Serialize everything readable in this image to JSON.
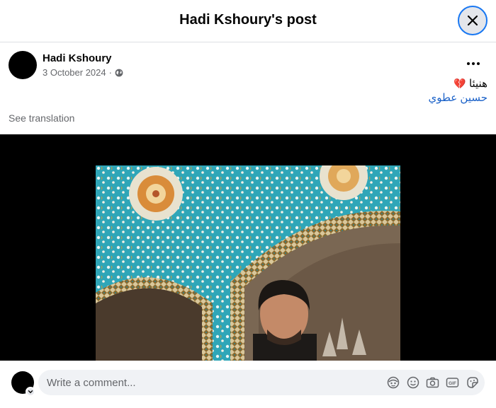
{
  "header": {
    "title": "Hadi Kshoury's post",
    "close_icon": "close-icon"
  },
  "post": {
    "author": "Hadi Kshoury",
    "date": "3 October 2024",
    "separator": "·",
    "audience_icon": "globe-icon",
    "more_icon": "more-options-icon",
    "caption": "هنيئا",
    "caption_emoji": "💔",
    "mention": "حسين عطوي",
    "see_translation": "See translation"
  },
  "comment": {
    "placeholder": "Write a comment...",
    "tools": [
      "avatar-sticker-icon",
      "emoji-icon",
      "camera-icon",
      "gif-icon",
      "sticker-icon"
    ]
  },
  "colors": {
    "link": "#1a61c8",
    "meta": "#65676b",
    "input_bg": "#f0f2f5",
    "focus_ring": "#1877f2"
  }
}
